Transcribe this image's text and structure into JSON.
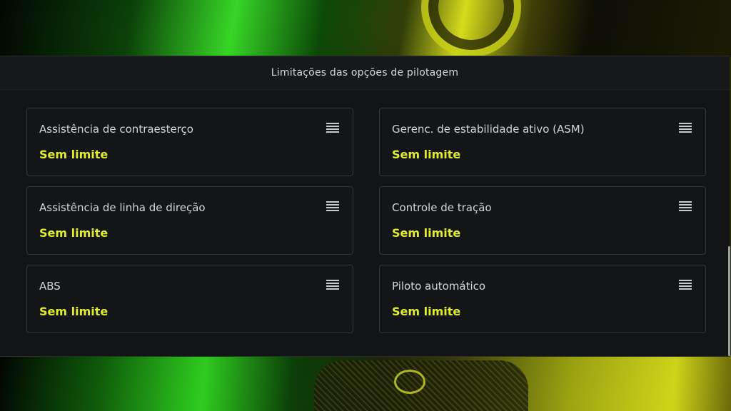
{
  "panel": {
    "title": "Limitações das opções de pilotagem"
  },
  "options": [
    {
      "label": "Assistência de contraesterço",
      "value": "Sem limite",
      "icon": "menu-icon"
    },
    {
      "label": "Gerenc. de estabilidade ativo (ASM)",
      "value": "Sem limite",
      "icon": "menu-icon"
    },
    {
      "label": "Assistência de linha de direção",
      "value": "Sem limite",
      "icon": "menu-icon"
    },
    {
      "label": "Controle de tração",
      "value": "Sem limite",
      "icon": "menu-icon"
    },
    {
      "label": "ABS",
      "value": "Sem limite",
      "icon": "menu-icon"
    },
    {
      "label": "Piloto automático",
      "value": "Sem limite",
      "icon": "menu-icon"
    }
  ],
  "colors": {
    "accent_value": "#e3ec2a",
    "panel_bg": "#121416",
    "card_border": "#33373b"
  }
}
